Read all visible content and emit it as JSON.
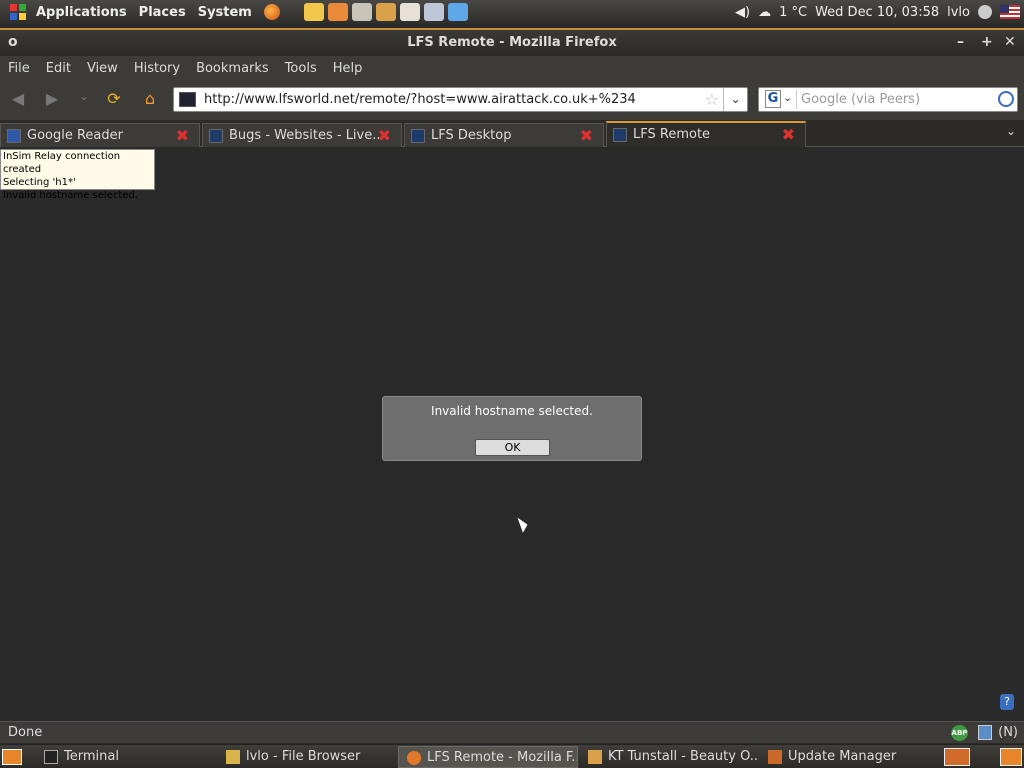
{
  "top_panel": {
    "menus": [
      "Applications",
      "Places",
      "System"
    ],
    "weather": "1 °C",
    "clock": "Wed Dec 10, 03:58",
    "user": "lvlo"
  },
  "window": {
    "title": "LFS Remote - Mozilla Firefox"
  },
  "menubar": {
    "items": [
      "File",
      "Edit",
      "View",
      "History",
      "Bookmarks",
      "Tools",
      "Help"
    ]
  },
  "navbar": {
    "url": "http://www.lfsworld.net/remote/?host=www.airattack.co.uk+%234",
    "search_placeholder": "Google (via Peers)",
    "search_engine_letter": "G"
  },
  "tabs": [
    {
      "label": "Google Reader",
      "active": false
    },
    {
      "label": "Bugs - Websites - Live...",
      "active": false
    },
    {
      "label": "LFS Desktop",
      "active": false
    },
    {
      "label": "LFS Remote",
      "active": true
    }
  ],
  "content": {
    "log_lines": [
      "InSim Relay connection created",
      "Selecting 'h1*'",
      "Invalid hostname selected."
    ],
    "dialog": {
      "message": "Invalid hostname selected.",
      "ok_label": "OK"
    },
    "help_label": "?"
  },
  "statusbar": {
    "status": "Done",
    "abp_label": "ABP",
    "noscript_label": "(N)"
  },
  "taskbar": {
    "items": [
      {
        "label": "Terminal",
        "active": false
      },
      {
        "label": "lvlo - File Browser",
        "active": false
      },
      {
        "label": "LFS Remote - Mozilla F...",
        "active": true
      },
      {
        "label": "KT Tunstall - Beauty O...",
        "active": false
      },
      {
        "label": "Update Manager",
        "active": false
      }
    ]
  },
  "colors": {
    "accent_orange": "#d89a3c",
    "close_red": "#e03030",
    "page_bg": "#2a2a2a"
  }
}
